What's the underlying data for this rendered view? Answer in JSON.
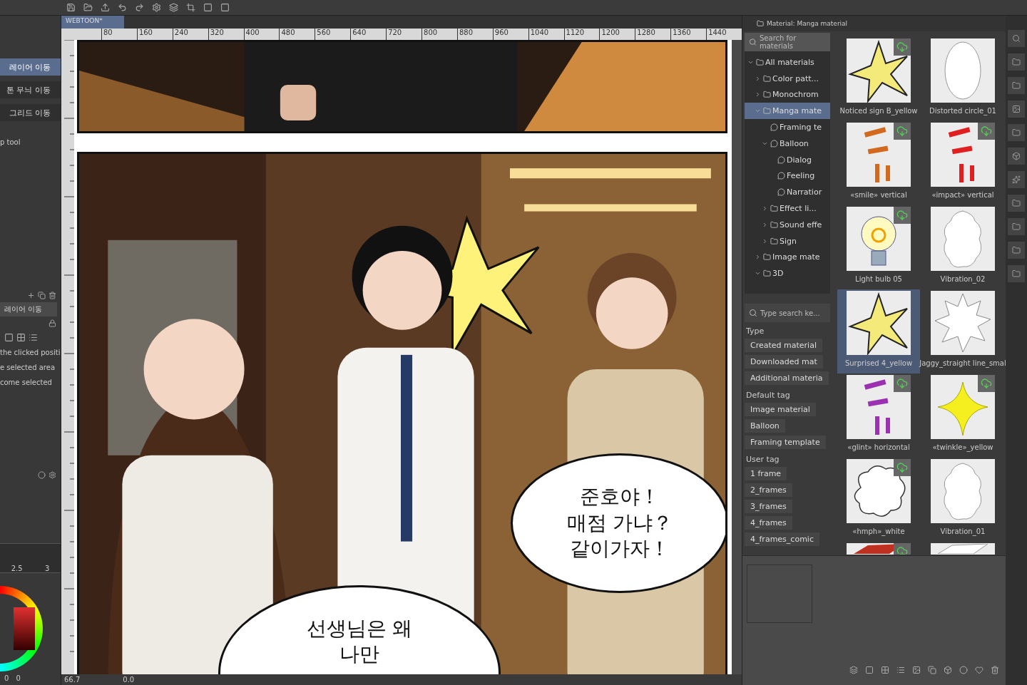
{
  "left_panel": {
    "sub_tools": [
      {
        "label": "레이어 이동",
        "selected": true
      },
      {
        "label": "톤 무늬 이동",
        "selected": false
      },
      {
        "label": "그리드 이동",
        "selected": false
      }
    ],
    "sub_tool_caption": "p tool",
    "property_tab": "레이어 이동",
    "options": [
      "the clicked positi",
      "e selected area",
      "come selected"
    ],
    "scale_labels": [
      "2.5",
      "3"
    ],
    "color_values": [
      "0",
      "0"
    ]
  },
  "canvas": {
    "tab": "WEBTOON*",
    "ruler_marks": [
      "80",
      "160",
      "240",
      "320",
      "400",
      "480",
      "560",
      "640",
      "720",
      "800",
      "880",
      "960",
      "1040",
      "1120",
      "1200",
      "1280",
      "1360",
      "1440"
    ],
    "balloons": [
      {
        "kind": "speech",
        "lines": [
          "준호야！",
          "매점 가냐？",
          "같이가자！"
        ]
      },
      {
        "kind": "thought",
        "lines": [
          "선생님은 왜",
          "나만"
        ]
      }
    ],
    "zoom": "66.7",
    "angle": "0.0"
  },
  "material_panel": {
    "title": "Material: Manga material",
    "search_placeholder": "Search for materials",
    "tree": [
      {
        "label": "All materials",
        "expanded": true,
        "selected": false,
        "children": [
          {
            "label": "Color patt...",
            "expanded": false,
            "selected": false
          },
          {
            "label": "Monochrom",
            "expanded": false,
            "selected": false
          },
          {
            "label": "Manga mate",
            "expanded": true,
            "selected": true,
            "children": [
              {
                "label": "Framing te",
                "selected": false
              },
              {
                "label": "Balloon",
                "expanded": true,
                "selected": false,
                "children": [
                  {
                    "label": "Dialog",
                    "selected": false
                  },
                  {
                    "label": "Feeling",
                    "selected": false
                  },
                  {
                    "label": "Narratior",
                    "selected": false
                  }
                ]
              },
              {
                "label": "Effect li...",
                "expanded": false,
                "selected": false
              },
              {
                "label": "Sound effe",
                "expanded": false,
                "selected": false
              },
              {
                "label": "Sign",
                "expanded": false,
                "selected": false
              }
            ]
          },
          {
            "label": "Image mate",
            "expanded": false,
            "selected": false
          },
          {
            "label": "3D",
            "expanded": true,
            "selected": false
          }
        ]
      }
    ],
    "tag_search_placeholder": "Type search ke...",
    "filter_groups": [
      {
        "title": "Type",
        "tags": [
          "Created material",
          "Downloaded mat",
          "Additional materia"
        ]
      },
      {
        "title": "Default tag",
        "tags": [
          "Image material",
          "Balloon",
          "Framing template"
        ]
      },
      {
        "title": "User tag",
        "tags": [
          "1 frame",
          "2_frames",
          "3_frames",
          "4_frames",
          "4_frames_comic"
        ]
      }
    ],
    "materials": [
      {
        "label": "Noticed sign B_yellow",
        "kind": "burst",
        "color": "#f4ea7a",
        "downloadable": true,
        "selected": false
      },
      {
        "label": "Distorted circle_01",
        "kind": "oval",
        "downloadable": false,
        "selected": false
      },
      {
        "label": "«smile» vertical",
        "kind": "strokes",
        "color": "#d2691e",
        "downloadable": true,
        "selected": false
      },
      {
        "label": "«impact» vertical",
        "kind": "strokes",
        "color": "#e02020",
        "downloadable": true,
        "selected": false
      },
      {
        "label": "Light bulb 05",
        "kind": "bulb",
        "downloadable": true,
        "selected": false
      },
      {
        "label": "Vibration_02",
        "kind": "blob",
        "downloadable": false,
        "selected": false
      },
      {
        "label": "Surprised 4_yellow",
        "kind": "burst",
        "color": "#f4ea7a",
        "downloadable": false,
        "selected": true
      },
      {
        "label": "Jaggy_straight line_smal",
        "kind": "jagged",
        "downloadable": false,
        "selected": false
      },
      {
        "label": "«glint» horizontal",
        "kind": "strokes",
        "color": "#9b30b0",
        "downloadable": true,
        "selected": false
      },
      {
        "label": "«twinkle»_yellow",
        "kind": "sparkle",
        "color": "#f5ef20",
        "downloadable": true,
        "selected": false
      },
      {
        "label": "«hmph»_white",
        "kind": "cloud",
        "downloadable": true,
        "selected": false
      },
      {
        "label": "Vibration_01",
        "kind": "blob",
        "downloadable": false,
        "selected": false
      },
      {
        "kind": "strokes",
        "color": "#c03020",
        "downloadable": true,
        "selected": false
      },
      {
        "kind": "oval",
        "downloadable": false,
        "selected": false
      }
    ]
  }
}
